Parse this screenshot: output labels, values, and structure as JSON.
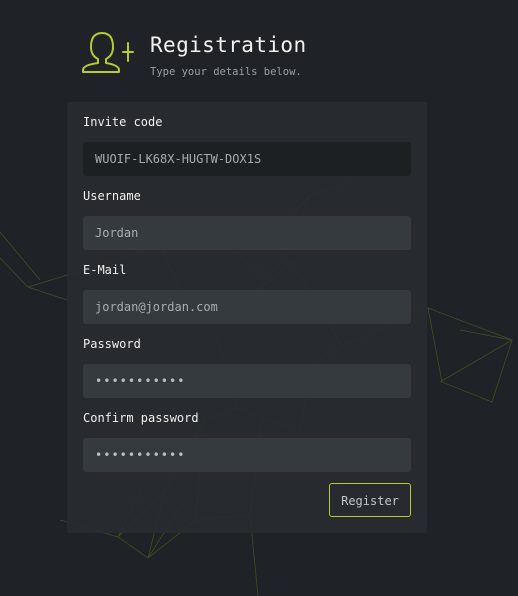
{
  "header": {
    "title": "Registration",
    "subtitle": "Type your details below."
  },
  "form": {
    "invite": {
      "label": "Invite code",
      "value": "WUOIF-LK68X-HUGTW-DOX1S"
    },
    "username": {
      "label": "Username",
      "value": "Jordan"
    },
    "email": {
      "label": "E-Mail",
      "value": "jordan@jordan.com"
    },
    "password": {
      "label": "Password",
      "value": "•••••••••••"
    },
    "confirm": {
      "label": "Confirm password",
      "value": "•••••••••••"
    },
    "submit_label": "Register"
  },
  "colors": {
    "accent": "#b4cc2c",
    "background": "#1f2226",
    "card": "#282c30",
    "input": "#353a3f"
  },
  "icons": [
    "add-user-icon"
  ]
}
